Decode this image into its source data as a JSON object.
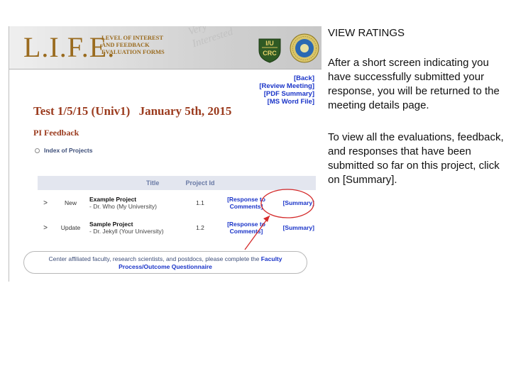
{
  "banner": {
    "logo": "L.I.F.E.",
    "subtitle_lines": [
      "LEVEL OF INTEREST",
      "AND FEEDBACK",
      "EVALUATION FORMS"
    ],
    "watermark_lines": [
      "Very",
      "Interested"
    ],
    "badge_top": "I/U",
    "badge_bottom": "CRC"
  },
  "links": [
    "[Back]",
    "[Review Meeting]",
    "[PDF Summary]",
    "[MS Word File]"
  ],
  "meeting": {
    "name": "Test 1/5/15 (Univ1)",
    "date": "January 5th, 2015"
  },
  "section_title": "PI Feedback",
  "index_label": "Index of Projects",
  "table": {
    "headers": [
      "",
      "",
      "Title",
      "Project Id",
      "",
      ""
    ],
    "rows": [
      {
        "arrow": ">",
        "status": "New",
        "name": "Example Project",
        "desc": "- Dr. Who (My University)",
        "id": "1.1",
        "response": "[Response to Comments]",
        "summary": "[Summary]"
      },
      {
        "arrow": ">",
        "status": "Update",
        "name": "Sample Project",
        "desc": "- Dr. Jekyll (Your University)",
        "id": "1.2",
        "response": "[Response to Comments]",
        "summary": "[Summary]"
      }
    ]
  },
  "notice": {
    "text": "Center affiliated faculty, research scientists, and postdocs, please complete the",
    "link_text": "Faculty Process/Outcome Questionnaire"
  },
  "annotation_color": "#d42a2a",
  "instructions": {
    "heading": "VIEW RATINGS",
    "p1": "After a short screen indicating you have successfully submitted your response, you will be returned to the meeting details page.",
    "p2": "To view all the evaluations, feedback, and responses that have been submitted so far on this project, click on [Summary]."
  }
}
